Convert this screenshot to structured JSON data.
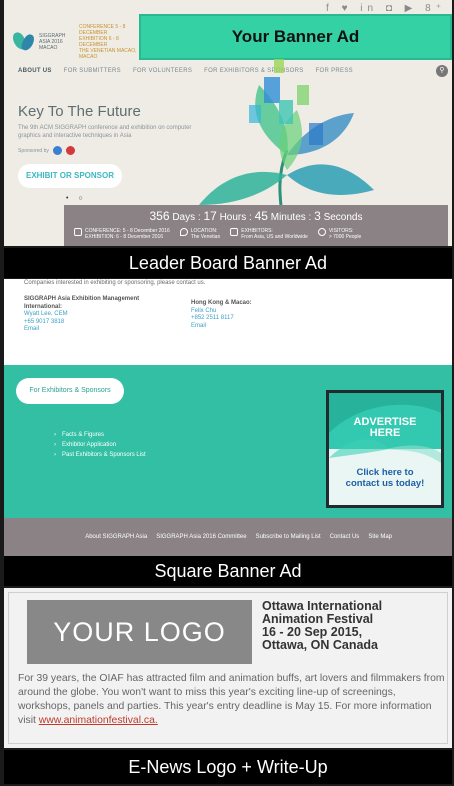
{
  "top_site": {
    "social_icons": [
      "facebook-icon",
      "twitter-icon",
      "linkedin-icon",
      "instagram-icon",
      "youtube-icon",
      "googleplus-icon"
    ],
    "social_text": "f ♥ in ◘ ▶ 8⁺",
    "logo_lines": [
      "SIGGRAPH",
      "ASIA 2016",
      "MACAO"
    ],
    "logo_dates": [
      "CONFERENCE 5 - 8 DECEMBER",
      "EXHIBITION 6 - 8 DECEMBER",
      "THE VENETIAN MACAO, MACAO"
    ],
    "banner_ad": "Your Banner Ad",
    "nav": [
      "ABOUT US",
      "FOR SUBMITTERS",
      "FOR VOLUNTEERS",
      "FOR EXHIBITORS & SPONSORS",
      "FOR PRESS"
    ],
    "hero_title": "Key To The Future",
    "hero_sub": "The 9th ACM SIGGRAPH conference and exhibition on computer graphics and interactive techniques in Asia",
    "sponsored_by": "Sponsored by",
    "exhibit_button": "EXHIBIT OR SPONSOR",
    "slider_dots": "• ○",
    "countdown": {
      "days": "356",
      "days_label": "Days :",
      "hours": "17",
      "hours_label": "Hours :",
      "minutes": "45",
      "minutes_label": "Minutes :",
      "seconds": "3",
      "seconds_label": "Seconds"
    },
    "info": {
      "conference": "CONFERENCE: 5 - 8 December 2016",
      "exhibition": "EXHIBITION: 6 - 8 December 2016",
      "location_label": "LOCATION:",
      "location": "The Venetian",
      "exhibitors_label": "EXHIBITORS:",
      "exhibitors": "From Asia, US and Worldwide",
      "visitors_label": "VISITORS:",
      "visitors": "> 7000 People"
    }
  },
  "labels": {
    "leaderboard": "Leader Board Banner Ad",
    "square": "Square Banner Ad",
    "enews": "E-News Logo + Write-Up"
  },
  "contact": {
    "intro": "Companies interested in exhibiting or sponsoring, please contact us.",
    "intl_heading": "SIGGRAPH Asia Exhibition Management International:",
    "intl_name": "Wyatt Lee, CEM",
    "intl_phone": "+65 9017 3818",
    "intl_email": "Email",
    "hk_heading": "Hong Kong & Macao:",
    "hk_name": "Felix Chu",
    "hk_phone": "+852 2511 8117",
    "hk_email": "Email"
  },
  "green": {
    "button": "For Exhibitors & Sponsors",
    "list": [
      "Facts & Figures",
      "Exhibitor Application",
      "Past Exhibitors & Sponsors List"
    ],
    "ad_line1": "ADVERTISE",
    "ad_line2": "HERE",
    "ad_click1": "Click here to",
    "ad_click2": "contact us today!"
  },
  "footer_nav": [
    "About SIGGRAPH Asia",
    "SIGGRAPH Asia 2016 Committee",
    "Subscribe to Mailing List",
    "Contact Us",
    "Site Map"
  ],
  "enews": {
    "logo_placeholder": "YOUR LOGO",
    "festival_line1": "Ottawa International",
    "festival_line2": "Animation Festival",
    "festival_line3": "16 - 20 Sep 2015,",
    "festival_line4": "Ottawa, ON Canada",
    "writeup": "For 39 years, the OIAF has attracted film and animation buffs, art lovers and filmmakers from around the globe. You won't want to miss this year's exciting line-up of screenings, workshops, panels and parties. This year's entry deadline is May 15. For more information visit ",
    "link": "www.animationfestival.ca."
  },
  "colors": {
    "teal": "#32bfa4",
    "banner_green": "#33d1a4",
    "gray_bar": "#8a8285",
    "label_black": "#000000"
  }
}
